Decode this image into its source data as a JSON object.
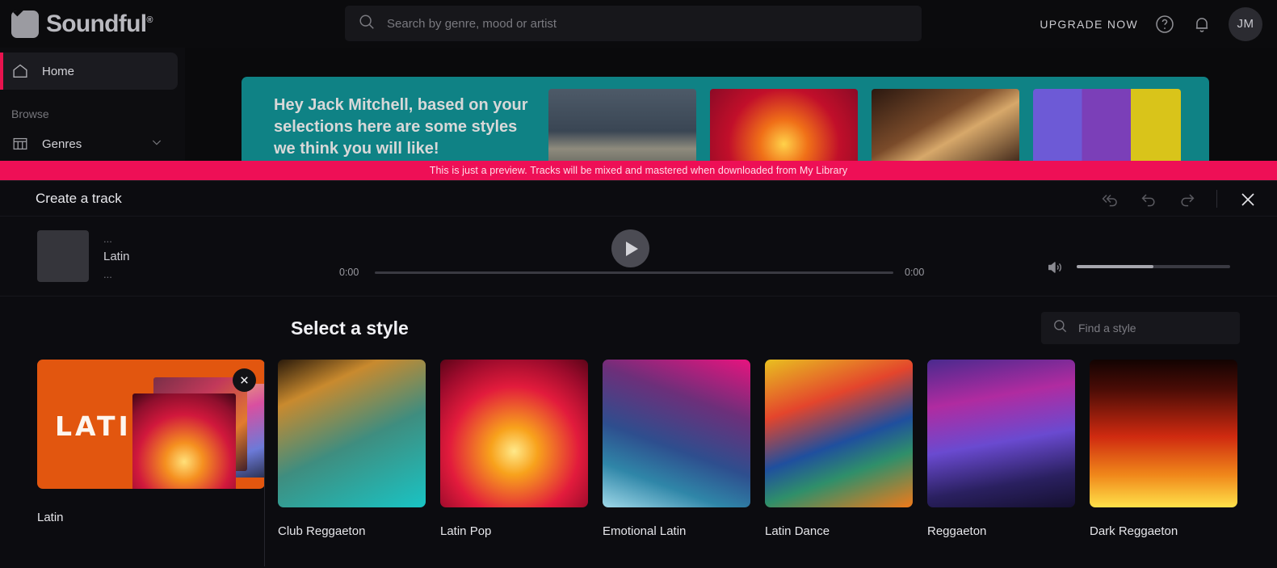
{
  "brand": {
    "name": "Soundful",
    "registered": "®"
  },
  "search": {
    "placeholder": "Search by genre, mood or artist",
    "value": ""
  },
  "header": {
    "upgrade_label": "UPGRADE NOW",
    "help_icon": "help-circle-icon",
    "notifications_icon": "bell-icon",
    "avatar_initials": "JM"
  },
  "sidebar": {
    "items": [
      {
        "label": "Home",
        "icon": "home-icon",
        "active": true
      }
    ],
    "section_label": "Browse",
    "browse_items": [
      {
        "label": "Genres",
        "icon": "genres-icon",
        "chevron": "chevron-down-icon"
      }
    ]
  },
  "promo": {
    "text": "Hey Jack Mitchell, based on your selections here are some styles we think you will like!",
    "cards": [
      "promo-card-1",
      "promo-card-2",
      "promo-card-3",
      "promo-card-4"
    ]
  },
  "notice": {
    "text": "This is just a preview. Tracks will be mixed and mastered when downloaded from My Library"
  },
  "create_track": {
    "title": "Create a track",
    "actions": [
      {
        "name": "reset-button",
        "icon": "reset-arrow-icon"
      },
      {
        "name": "undo-button",
        "icon": "undo-icon"
      },
      {
        "name": "redo-button",
        "icon": "redo-icon"
      },
      {
        "name": "close-button",
        "icon": "close-icon"
      }
    ]
  },
  "player": {
    "artwork": "track-artwork-placeholder",
    "line1": "...",
    "title": "Latin",
    "line3": "...",
    "play_icon": "play-icon",
    "current_time": "0:00",
    "total_time": "0:00",
    "progress_percent": 0,
    "volume_icon": "speaker-icon",
    "volume_percent": 50
  },
  "styles": {
    "heading": "Select a style",
    "find": {
      "placeholder": "Find a style",
      "value": "",
      "icon": "search-icon"
    },
    "selected": {
      "label": "Latin",
      "card_word": "LATIN",
      "card_color": "#e2560f",
      "remove_icon": "close-icon"
    },
    "items": [
      {
        "label": "Club Reggaeton",
        "art": "g-club"
      },
      {
        "label": "Latin Pop",
        "art": "g-latinpop"
      },
      {
        "label": "Emotional Latin",
        "art": "g-emotion"
      },
      {
        "label": "Latin Dance",
        "art": "g-dance"
      },
      {
        "label": "Reggaeton",
        "art": "g-reg"
      },
      {
        "label": "Dark Reggaeton",
        "art": "g-dark"
      }
    ]
  },
  "colors": {
    "accent_pink": "#ee0f56",
    "promo_teal": "#0f8285",
    "selected_orange": "#e2560f",
    "background": "#0a0a0c"
  }
}
